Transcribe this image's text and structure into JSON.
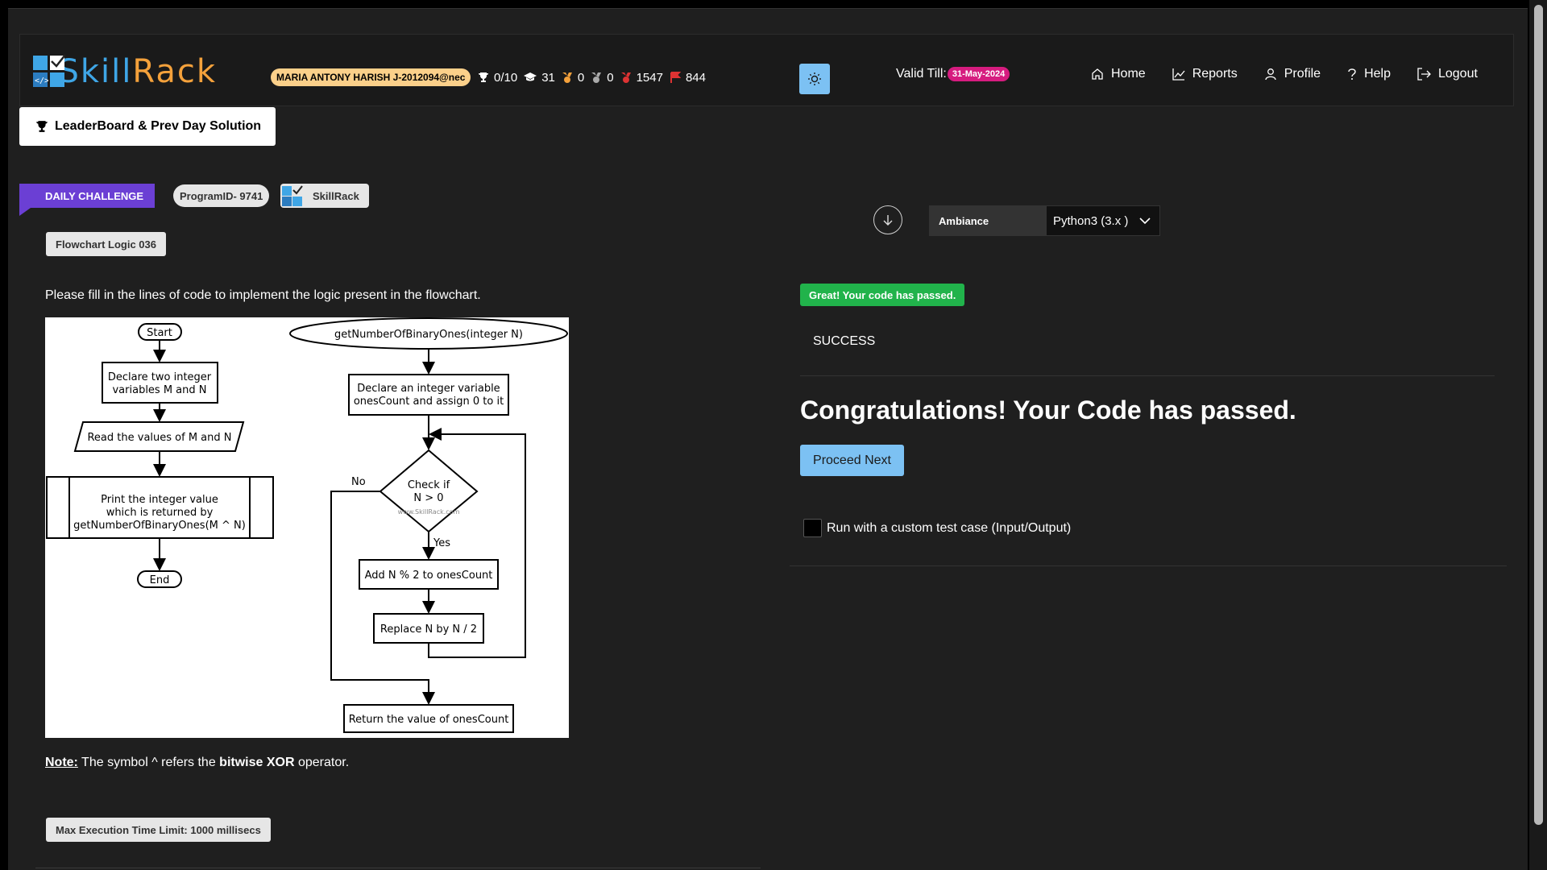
{
  "brand": {
    "logo_part1": "Skill",
    "logo_part2": "Rack",
    "logo_colors": {
      "blue": "#3fa6e6",
      "orange": "#f4a13b"
    }
  },
  "header": {
    "user_badge": "MARIA ANTONY HARISH J-2012094@nec",
    "stats": [
      {
        "icon": "trophy-icon",
        "value": "0/10"
      },
      {
        "icon": "graduation-cap-icon",
        "value": "31"
      },
      {
        "icon": "gold-medal-icon",
        "value": "0"
      },
      {
        "icon": "silver-medal-icon",
        "value": "0"
      },
      {
        "icon": "red-medal-icon",
        "value": "1547"
      },
      {
        "icon": "flag-icon",
        "value": "844"
      }
    ],
    "valid_label": "Valid Till:",
    "valid_date": "31-May-2024",
    "nav": [
      {
        "icon": "home-icon",
        "label": "Home"
      },
      {
        "icon": "chart-icon",
        "label": "Reports"
      },
      {
        "icon": "user-icon",
        "label": "Profile"
      },
      {
        "icon": "help-icon",
        "label": "Help"
      },
      {
        "icon": "logout-icon",
        "label": "Logout"
      }
    ]
  },
  "leaderboard_button": "LeaderBoard & Prev Day Solution",
  "challenge": {
    "daily_label": "DAILY CHALLENGE",
    "program_id": "ProgramID- 9741",
    "source": "SkillRack",
    "title": "Flowchart Logic 036",
    "description": "Please fill in the lines of code to implement the logic present in the flowchart.",
    "note_label": "Note:",
    "note_text_1": " The symbol ^ refers the ",
    "note_bold": "bitwise XOR",
    "note_text_2": " operator.",
    "time_limit": "Max Execution Time Limit: 1000 millisecs"
  },
  "flowchart": {
    "start": "Start",
    "declare": [
      "Declare two integer",
      "variables M and N"
    ],
    "read": "Read the values of M and N",
    "print": [
      "Print the integer value",
      "which is returned by",
      "getNumberOfBinaryOnes(M ^ N)"
    ],
    "end": "End",
    "func": "getNumberOfBinaryOnes(integer N)",
    "declare_ones": [
      "Declare an integer variable",
      "onesCount and assign 0 to it"
    ],
    "check": [
      "Check if",
      "N > 0"
    ],
    "no": "No",
    "yes": "Yes",
    "watermark": "www.SkillRack.com",
    "add": "Add N % 2 to onesCount",
    "replace": "Replace N by N / 2",
    "return": "Return the value of onesCount"
  },
  "editor": {
    "ambiance_label": "Ambiance",
    "language": "Python3 (3.x )",
    "passed_badge": "Great! Your code has passed.",
    "status": "SUCCESS",
    "congrats": "Congratulations! Your Code has passed.",
    "proceed_label": "Proceed Next",
    "custom_test_label": "Run with a custom test case (Input/Output)",
    "custom_test_checked": false
  }
}
